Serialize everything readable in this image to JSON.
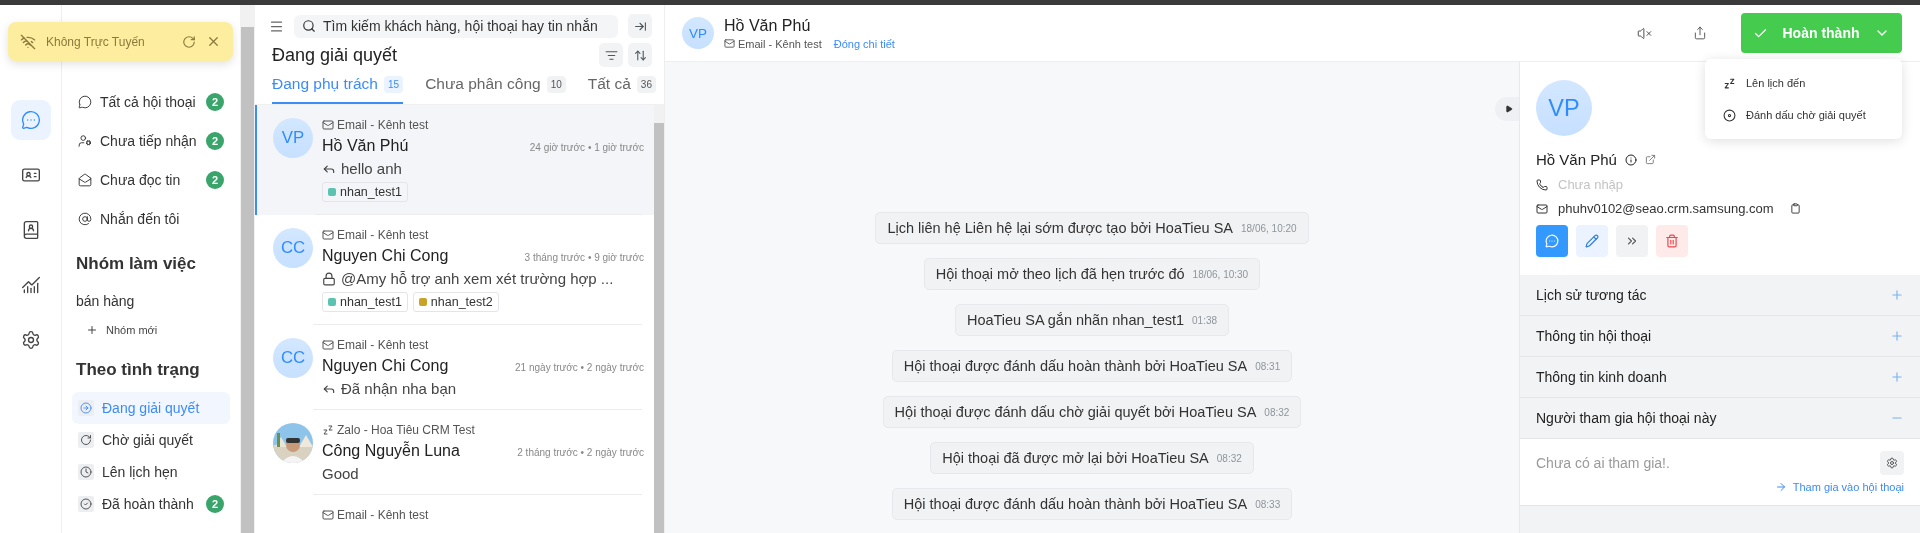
{
  "offline_toast": {
    "text": "Không Trực Tuyến"
  },
  "rail": [
    {
      "kind": "chat",
      "selected": true
    },
    {
      "kind": "card",
      "selected": false
    },
    {
      "kind": "contacts",
      "selected": false
    },
    {
      "kind": "chart",
      "selected": false
    },
    {
      "kind": "settings",
      "selected": false
    }
  ],
  "nav": {
    "items": [
      {
        "kind": "all",
        "label": "Tất cả hội thoại",
        "count": "2",
        "selected": false
      },
      {
        "kind": "unassigned",
        "label": "Chưa tiếp nhận",
        "count": "2",
        "selected": false
      },
      {
        "kind": "unread",
        "label": "Chưa đọc tin",
        "count": "2",
        "selected": false
      },
      {
        "kind": "mention",
        "label": "Nhắn đến tôi",
        "selected": false
      }
    ],
    "groups_title": "Nhóm làm việc",
    "groups": [
      {
        "label": "bán hàng",
        "selected": false
      }
    ],
    "new_group": "Nhóm mới",
    "status_title": "Theo tình trạng",
    "status_items": [
      {
        "kind": "open",
        "label": "Đang giải quyết",
        "selected": true
      },
      {
        "kind": "pending",
        "label": "Chờ giải quyết",
        "selected": false
      },
      {
        "kind": "scheduled",
        "label": "Lên lịch hẹn",
        "selected": false
      },
      {
        "kind": "done",
        "label": "Đã hoàn thành",
        "count": "2",
        "selected": false
      }
    ]
  },
  "search": {
    "placeholder": "Tìm kiếm khách hàng, hội thoại hay tin nhắn"
  },
  "list_title": "Đang giải quyết",
  "tabs": [
    {
      "label": "Đang phụ trách",
      "count": "15",
      "selected": true
    },
    {
      "label": "Chưa phân công",
      "count": "10",
      "selected": false
    },
    {
      "label": "Tất cả",
      "count": "36",
      "selected": false
    }
  ],
  "conversations": [
    {
      "channel": {
        "kind": "email",
        "label": "Email - Kênh test"
      },
      "avatar": {
        "kind": "initials",
        "text": "VP"
      },
      "name": "Hồ Văn Phú",
      "time": "24 giờ trước • 1 giờ trước",
      "preview": {
        "kind": "reply",
        "text": "hello anh"
      },
      "tags": [
        {
          "label": "nhan_test1",
          "color": "#5cc3b0"
        }
      ],
      "selected": true
    },
    {
      "channel": {
        "kind": "email",
        "label": "Email - Kênh test"
      },
      "avatar": {
        "kind": "initials",
        "text": "CC"
      },
      "name": "Nguyen Chi Cong",
      "time": "3 tháng trước • 9 giờ trước",
      "preview": {
        "kind": "lock",
        "text": "@Amy hỗ trợ anh xem xét trường hợp ..."
      },
      "tags": [
        {
          "label": "nhan_test1",
          "color": "#5cc3b0"
        },
        {
          "label": "nhan_test2",
          "color": "#c9a227"
        }
      ],
      "selected": false
    },
    {
      "channel": {
        "kind": "email",
        "label": "Email - Kênh test"
      },
      "avatar": {
        "kind": "initials",
        "text": "CC"
      },
      "name": "Nguyen Chi Cong",
      "time": "21 ngày trước • 2 ngày trước",
      "preview": {
        "kind": "reply",
        "text": "Đã nhận nha bạn"
      },
      "selected": false
    },
    {
      "channel": {
        "kind": "zalo",
        "label": "Zalo - Hoa Tiêu CRM Test"
      },
      "name": "Công Nguyễn Luna",
      "time": "2 tháng trước • 2 ngày trước",
      "preview": {
        "text": "Good"
      },
      "selected": false
    },
    {
      "channel": {
        "kind": "email",
        "label": "Email - Kênh test"
      },
      "selected": false
    }
  ],
  "chat_header": {
    "avatar": "VP",
    "name": "Hồ Văn Phú",
    "channel": "Email - Kênh test",
    "link": "Đóng chi tiết"
  },
  "complete_button": {
    "label": "Hoàn thành"
  },
  "dropdown": [
    {
      "kind": "snooze",
      "label": "Lên lịch đến"
    },
    {
      "kind": "pending",
      "label": "Đánh dấu chờ giải quyết"
    }
  ],
  "messages": [
    {
      "text": "Lịch liên hệ Liên hệ lại sớm được tạo bởi HoaTieu SA",
      "time": "18/06, 10:20"
    },
    {
      "text": "Hội thoại mở theo lịch đã hẹn trước đó",
      "time": "18/06, 10:30"
    },
    {
      "text": "HoaTieu SA gắn nhãn nhan_test1",
      "time": "01:38"
    },
    {
      "text": "Hội thoại được đánh dấu hoàn thành bởi HoaTieu SA",
      "time": "08:31"
    },
    {
      "text": "Hội thoại được đánh dấu chờ giải quyết bởi HoaTieu SA",
      "time": "08:32"
    },
    {
      "text": "Hội thoại đã được mở lại bởi HoaTieu SA",
      "time": "08:32"
    },
    {
      "text": "Hội thoại được đánh dấu hoàn thành bởi HoaTieu SA",
      "time": "08:33"
    }
  ],
  "contact": {
    "avatar": "VP",
    "name": "Hồ Văn Phú",
    "phone": {
      "placeholder": "Chưa nhập"
    },
    "email": "phuhv0102@seao.crm.samsung.com"
  },
  "contact_actions": [
    {
      "kind": "chat"
    },
    {
      "kind": "edit"
    },
    {
      "kind": "forward"
    },
    {
      "kind": "delete"
    }
  ],
  "sections": [
    {
      "title": "Lịch sử tương tác",
      "expanded": false
    },
    {
      "title": "Thông tin hội thoại",
      "expanded": false
    },
    {
      "title": "Thông tin kinh doanh",
      "expanded": false
    },
    {
      "title": "Người tham gia hội thoại này",
      "expanded": true
    }
  ],
  "participants": {
    "empty": "Chưa có ai tham gia!.",
    "join": "Tham gia vào hội thoại"
  }
}
